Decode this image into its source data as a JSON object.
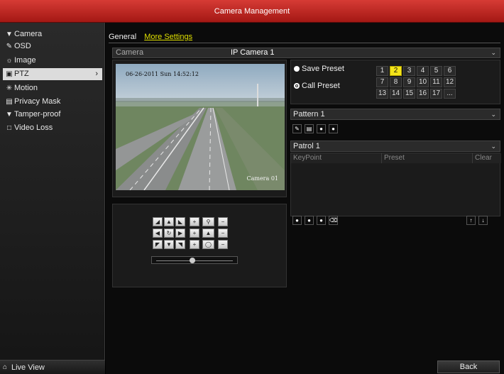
{
  "window": {
    "title": "Camera Management"
  },
  "sidebar": {
    "items": [
      {
        "label": "Camera",
        "icon": "camera-icon"
      },
      {
        "label": "OSD",
        "icon": "osd-icon"
      },
      {
        "label": "Image",
        "icon": "image-icon"
      },
      {
        "label": "PTZ",
        "icon": "ptz-icon",
        "active": true
      },
      {
        "label": "Motion",
        "icon": "motion-icon"
      },
      {
        "label": "Privacy Mask",
        "icon": "privacy-mask-icon"
      },
      {
        "label": "Tamper-proof",
        "icon": "tamper-proof-icon"
      },
      {
        "label": "Video Loss",
        "icon": "video-loss-icon"
      }
    ],
    "live_view": "Live View"
  },
  "tabs": {
    "general": "General",
    "more_settings": "More Settings"
  },
  "camera": {
    "label": "Camera",
    "value": "IP Camera 1"
  },
  "video": {
    "timestamp": "06-26-2011 Sun 14:52:12",
    "camera_name": "Camera 01"
  },
  "preset": {
    "save_label": "Save Preset",
    "call_label": "Call Preset",
    "selected": "call",
    "numbers": [
      "1",
      "2",
      "3",
      "4",
      "5",
      "6",
      "7",
      "8",
      "9",
      "10",
      "11",
      "12",
      "13",
      "14",
      "15",
      "16",
      "17",
      "..."
    ],
    "highlighted": "2"
  },
  "pattern": {
    "value": "Pattern 1"
  },
  "patrol": {
    "value": "Patrol 1",
    "columns": [
      "KeyPoint",
      "Preset",
      "Clear"
    ]
  },
  "buttons": {
    "back": "Back"
  },
  "colors": {
    "title_bar": "#c0261f",
    "highlight": "#f4e41a",
    "accent_tab": "#e0e000"
  }
}
